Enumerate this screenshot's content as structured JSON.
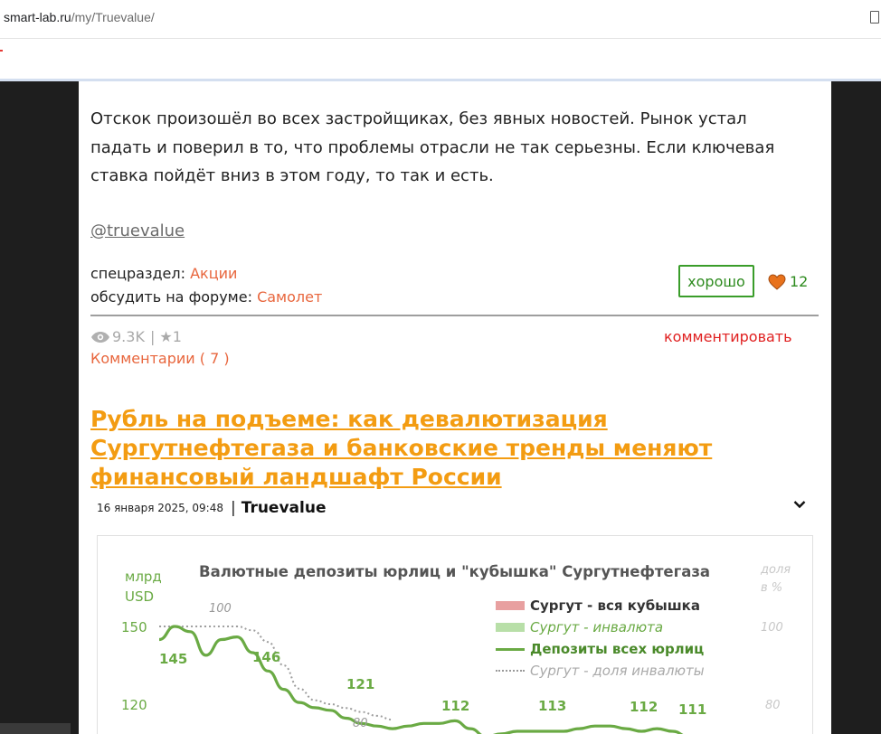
{
  "browser": {
    "url_host": "smart-lab.ru",
    "url_path": "/my/Truevalue/"
  },
  "post": {
    "text": "Отскок произошёл во всех застройщиках, без явных новостей. Рынок устал падать и поверил в то, что проблемы отрасли не так серьезны. Если ключевая ставка пойдёт вниз в этом году, то так и есть.",
    "author_handle": "@truevalue",
    "subsection_label": "спецраздел:",
    "subsection_value": "Акции",
    "forum_label": "обсудить на форуме:",
    "forum_value": "Самолет",
    "good_button": "хорошо",
    "likes": "12",
    "views": "9.3K",
    "stars": "| ★1",
    "comment_button": "комментировать",
    "comments_link": "Комментарии ( 7 )"
  },
  "article": {
    "title": "Рубль на подъеме: как девалютизация Сургутнефтегаза и банковские тренды меняют финансовый ландшафт России",
    "date": "16 января 2025, 09:48",
    "separator": "|",
    "author": "Truevalue"
  },
  "chart_data": {
    "type": "line",
    "title": "Валютные депозиты юрлиц и \"кубышка\" Сургутнефтегаза",
    "ylabel": "млрд USD",
    "y2label": "доля в %",
    "yticks": [
      "150",
      "120"
    ],
    "y2ticks": [
      "100",
      "80"
    ],
    "ylim": [
      100,
      160
    ],
    "y2lim": [
      70,
      105
    ],
    "legend": [
      {
        "name": "Сургут - вся кубышка",
        "color": "#e8a0a0"
      },
      {
        "name": "Сургут - инвалюта",
        "color": "#b8dfa8"
      },
      {
        "name": "Депозиты всех юрлиц",
        "color": "#6aaa44"
      },
      {
        "name": "Сургут - доля инвалюты",
        "color": "#aaaaaa"
      }
    ],
    "series": [
      {
        "name": "Депозиты всех юрлиц",
        "x": [
          0,
          1,
          2,
          3,
          4,
          5,
          6,
          7,
          8,
          9,
          10,
          11,
          12,
          13,
          14,
          15,
          16,
          17,
          18,
          19,
          20,
          21,
          22,
          23,
          24,
          25,
          26,
          27,
          28,
          29,
          30,
          31,
          32,
          33,
          34,
          35
        ],
        "values": [
          145,
          150,
          148,
          139,
          145,
          146,
          140,
          133,
          126,
          121,
          119,
          118,
          115,
          113,
          112,
          111,
          112,
          113,
          113,
          114,
          111,
          108,
          109,
          110,
          110,
          110,
          110,
          111,
          112,
          112,
          111,
          110,
          111,
          110,
          108,
          108
        ]
      },
      {
        "name": "Сургут - доля инвалюты",
        "x": [
          0,
          1,
          2,
          3,
          4,
          5,
          6,
          7,
          8,
          9,
          10,
          11,
          12,
          13,
          14,
          15
        ],
        "values": [
          100,
          100,
          100,
          100,
          100,
          100,
          99,
          96,
          90,
          84,
          81,
          80,
          79,
          78,
          77,
          76
        ]
      }
    ],
    "data_labels": [
      {
        "text": "145",
        "series": "Депозиты всех юрлиц"
      },
      {
        "text": "146",
        "series": "Депозиты всех юрлиц"
      },
      {
        "text": "121",
        "series": "Депозиты всех юрлиц"
      },
      {
        "text": "112",
        "series": "Депозиты всех юрлиц"
      },
      {
        "text": "113",
        "series": "Депозиты всех юрлиц"
      },
      {
        "text": "112",
        "series": "Депозиты всех юрлиц"
      },
      {
        "text": "111",
        "series": "Депозиты всех юрлиц"
      },
      {
        "text": "100",
        "series": "Сургут - доля инвалюты"
      },
      {
        "text": "80",
        "series": "Сургут - доля инвалюты"
      }
    ]
  }
}
